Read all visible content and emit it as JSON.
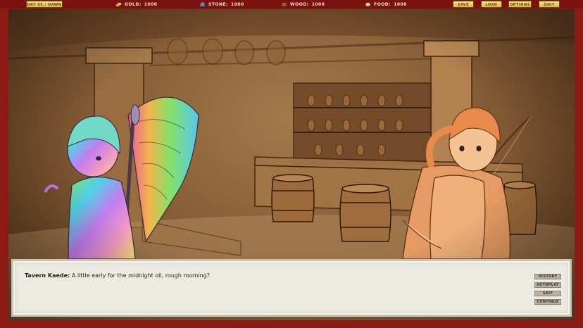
{
  "header": {
    "day_label": "DAY 05 / DAWN",
    "resources": [
      {
        "icon": "gold-coins-icon",
        "label": "GOLD:",
        "value": "1000"
      },
      {
        "icon": "stone-icon",
        "label": "STONE:",
        "value": "1000"
      },
      {
        "icon": "wood-logs-icon",
        "label": "WOOD:",
        "value": "1000"
      },
      {
        "icon": "food-icon",
        "label": "FOOD:",
        "value": "1000"
      }
    ],
    "menu": {
      "save": "SAVE",
      "load": "LOAD",
      "options": "OPTIONS",
      "quit": "QUIT"
    }
  },
  "dialog": {
    "speaker": "Tavern Kaede:",
    "text": "A little early for the midnight oil, rough morning?",
    "controls": {
      "history": "HISTORY",
      "autoplay": "AUTOPLAY",
      "skip": "SKIP",
      "continue": "CONTINUE"
    }
  },
  "colors": {
    "frame": "#8c1a14",
    "button_gold": "#e8cf66",
    "dialog_bg": "#ecebe2"
  }
}
